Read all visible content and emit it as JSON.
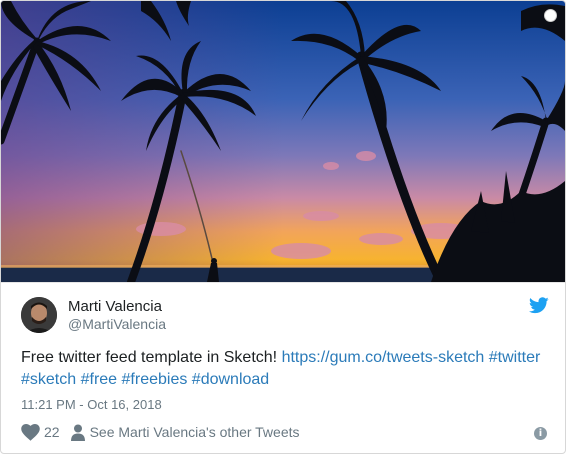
{
  "tweet": {
    "author_name": "Marti Valencia",
    "author_handle": "@MartiValencia",
    "text_plain": "Free twitter feed template in Sketch! ",
    "link": "https://gum.co/tweets-sketch",
    "hashtags": [
      "#twitter",
      "#sketch",
      "#free",
      "#freebies",
      "#download"
    ],
    "timestamp": "11:21 PM - Oct 16, 2018",
    "likes": "22",
    "other_tweets_label": "See Marti Valencia's other Tweets",
    "info_glyph": "i"
  },
  "icons": {
    "brand": "twitter-bird-icon",
    "like": "heart-icon",
    "profile": "person-icon",
    "info": "info-icon",
    "status": "status-dot-icon"
  },
  "colors": {
    "link": "#2b7bb9",
    "brand": "#1da1f2",
    "muted": "#697882",
    "text": "#1c2022"
  }
}
